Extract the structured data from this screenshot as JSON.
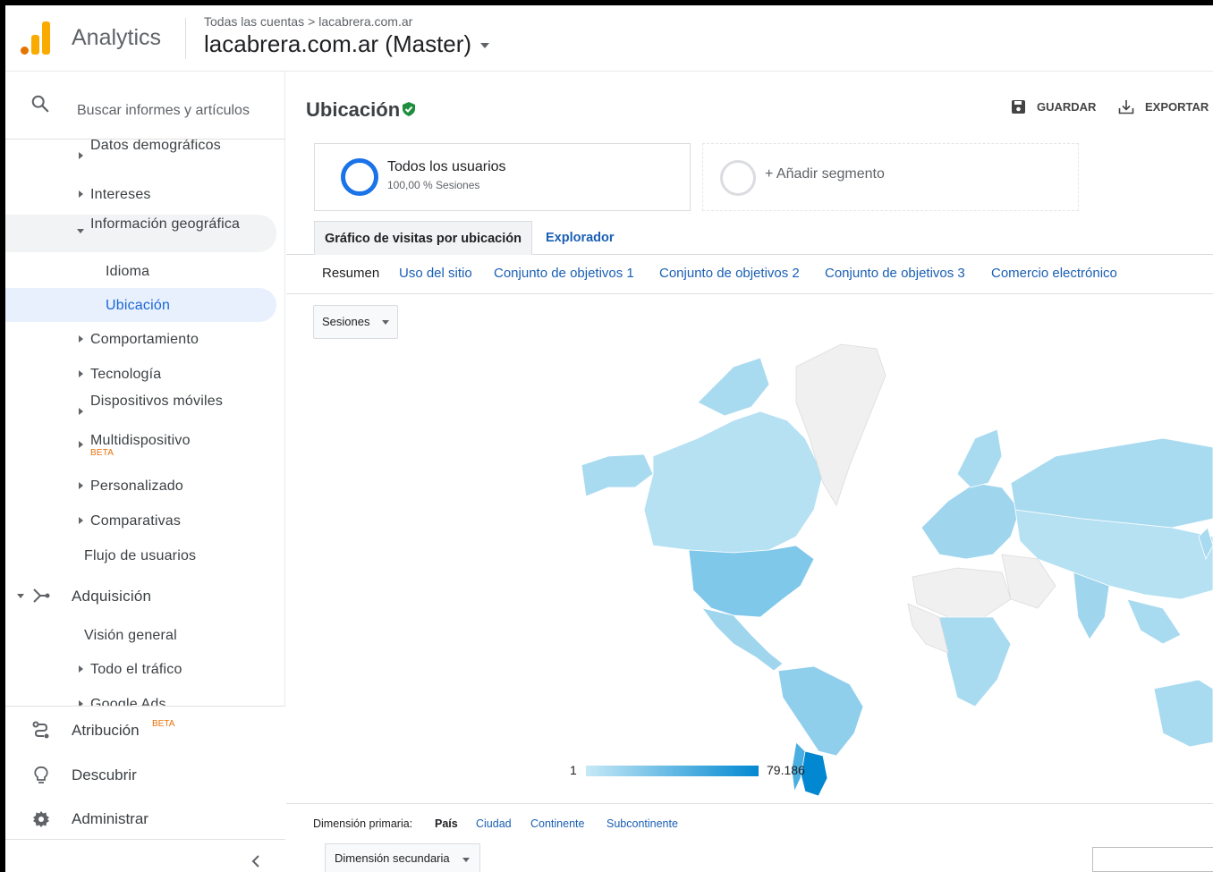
{
  "header": {
    "app_name": "Analytics",
    "breadcrumb_root": "Todas las cuentas",
    "breadcrumb_sep": ">",
    "breadcrumb_property": "lacabrera.com.ar",
    "account_view": "lacabrera.com.ar (Master)"
  },
  "sidebar": {
    "search_placeholder": "Buscar informes y artículos",
    "items": [
      {
        "label": "Datos demográficos"
      },
      {
        "label": "Intereses"
      },
      {
        "label": "Información geográfica"
      },
      {
        "label": "Idioma"
      },
      {
        "label": "Ubicación"
      },
      {
        "label": "Comportamiento"
      },
      {
        "label": "Tecnología"
      },
      {
        "label": "Dispositivos móviles"
      },
      {
        "label": "Multidispositivo",
        "badge": "BETA"
      },
      {
        "label": "Personalizado"
      },
      {
        "label": "Comparativas"
      },
      {
        "label": "Flujo de usuarios"
      },
      {
        "label": "Adquisición"
      },
      {
        "label": "Visión general"
      },
      {
        "label": "Todo el tráfico"
      },
      {
        "label": "Google Ads"
      }
    ],
    "bottom": {
      "attribution": "Atribución",
      "attribution_badge": "BETA",
      "discover": "Descubrir",
      "admin": "Administrar"
    }
  },
  "report": {
    "title": "Ubicación",
    "save_label": "GUARDAR",
    "export_label": "EXPORTAR",
    "segment1_name": "Todos los usuarios",
    "segment1_sub": "100,00 % Sesiones",
    "segment2_name": "+ Añadir segmento",
    "tabs": [
      "Gráfico de visitas por ubicación",
      "Explorador"
    ],
    "subtabs": [
      "Resumen",
      "Uso del sitio",
      "Conjunto de objetivos 1",
      "Conjunto de objetivos 2",
      "Conjunto de objetivos 3",
      "Comercio electrónico"
    ],
    "metric": "Sesiones",
    "legend_min": "1",
    "legend_max": "79.186",
    "primary_dimension_label": "Dimensión primaria:",
    "dimensions": [
      "País",
      "Ciudad",
      "Continente",
      "Subcontinente"
    ],
    "secondary_dimension": "Dimensión secundaria"
  },
  "colors": {
    "brand_orange": "#f9ab00",
    "brand_dark_orange": "#e37400",
    "accent_blue": "#1a73e8",
    "map_high": "#0288d1",
    "map_low": "#c6e9f6",
    "map_none": "#f0f0f0",
    "check_green": "#1e8e3e"
  }
}
